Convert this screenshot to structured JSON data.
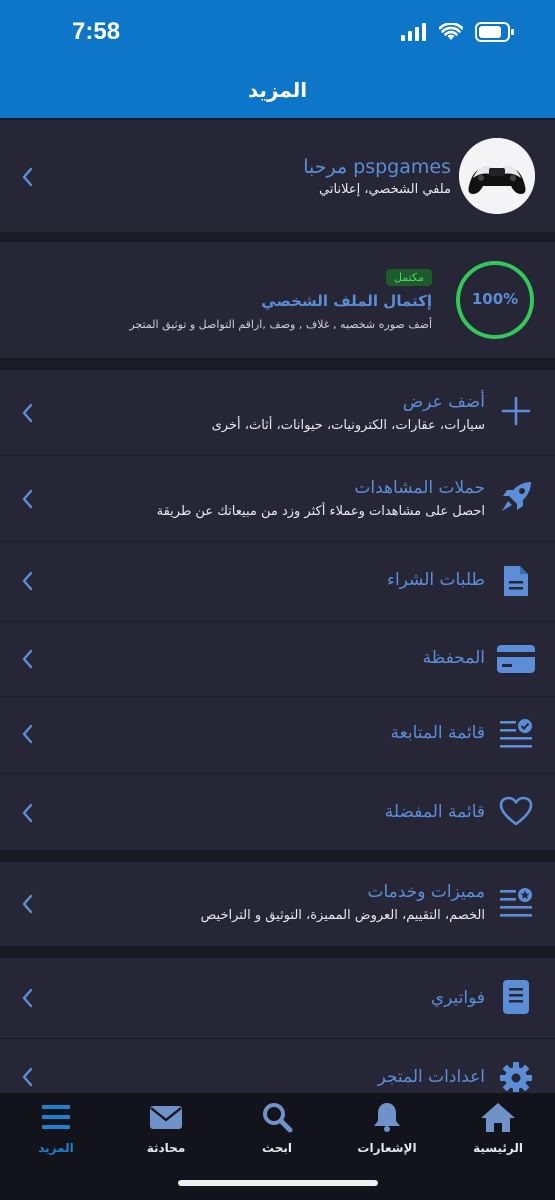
{
  "status": {
    "time": "7:58"
  },
  "header": {
    "title": "المزيد"
  },
  "profile": {
    "greeting": "مرحبا pspgames",
    "subtitle": "ملفي الشخصي، إعلاناتي"
  },
  "completion": {
    "percent_label": "100%",
    "percent_value": 100,
    "badge": "مكتمل",
    "title": "إكتمال الملف الشخصي",
    "subtitle": "أضف صوره شخصيه , غلاف , وصف ,اراقم التواصل و توثيق المتجر"
  },
  "menu": {
    "add_ad": {
      "title": "أضف عرض",
      "subtitle": "سيارات، عقارات، الكترونيات، حيوانات، أثاث، أخرى"
    },
    "views": {
      "title": "حملات المشاهدات",
      "subtitle": "احصل على مشاهدات وعملاء أكثر وزد من مبيعاتك عن طريقة"
    },
    "purchase_orders": {
      "title": "طلبات الشراء"
    },
    "wallet": {
      "title": "المحفظة"
    },
    "follow_list": {
      "title": "قائمة المتابعة"
    },
    "favorites": {
      "title": "قائمة المفضلة"
    },
    "features": {
      "title": "مميزات وخدمات",
      "subtitle": "الخصم، التقييم، العروض المميزة، التوثيق و التراخيص"
    },
    "invoices": {
      "title": "فواتيري"
    },
    "store_settings": {
      "title": "اعدادات المتجر"
    }
  },
  "tabs": {
    "home": "الرئيسية",
    "notifications": "الإشعارات",
    "search": "ابحث",
    "chat": "محادثة",
    "more": "المزيد"
  },
  "colors": {
    "brand": "#0e76c8",
    "accent_blue": "#5b8ed6",
    "success": "#34c759",
    "background": "#1b1b26",
    "card": "#262636"
  }
}
